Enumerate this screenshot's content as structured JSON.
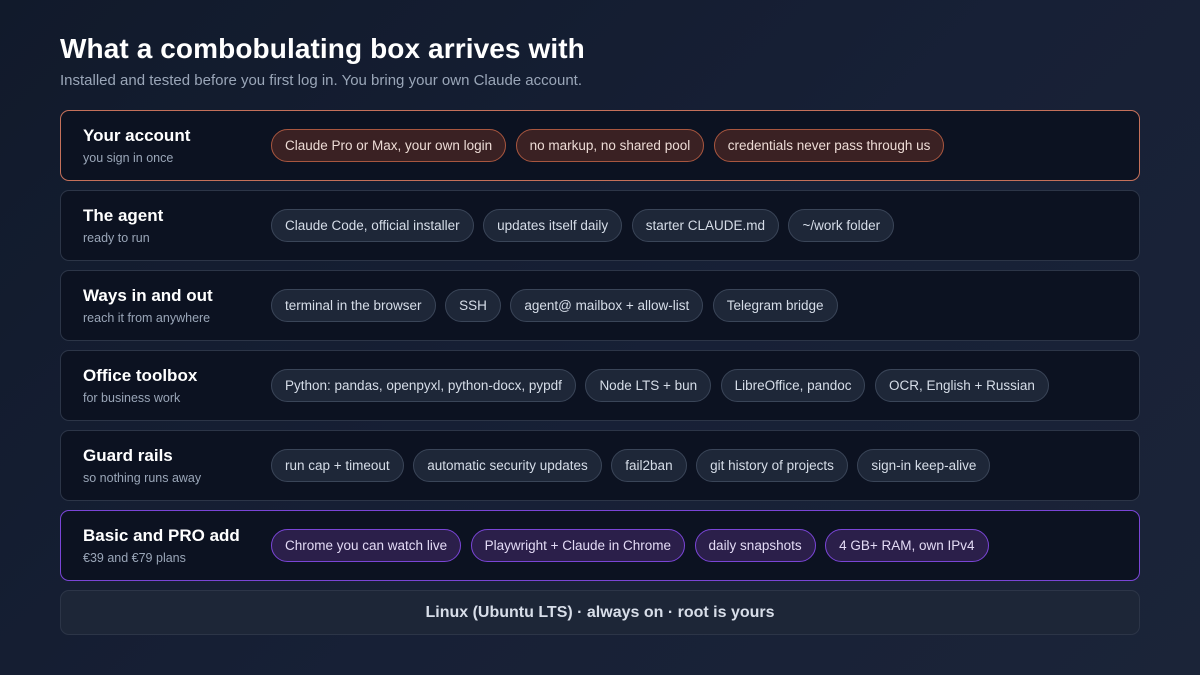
{
  "header": {
    "title": "What a combobulating box arrives with",
    "subtitle": "Installed and tested before you first log in. You bring your own Claude account."
  },
  "accent_colors": {
    "orange": "#c5705a",
    "purple": "#7a45d6"
  },
  "rows": [
    {
      "title": "Your account",
      "subtitle": "you sign in once",
      "accent": "orange",
      "chips": [
        "Claude Pro or Max, your own login",
        "no markup, no shared pool",
        "credentials never pass through us"
      ]
    },
    {
      "title": "The agent",
      "subtitle": "ready to run",
      "accent": "none",
      "chips": [
        "Claude Code, official installer",
        "updates itself daily",
        "starter CLAUDE.md",
        "~/work folder"
      ]
    },
    {
      "title": "Ways in and out",
      "subtitle": "reach it from anywhere",
      "accent": "none",
      "chips": [
        "terminal in the browser",
        "SSH",
        "agent@ mailbox + allow-list",
        "Telegram bridge"
      ]
    },
    {
      "title": "Office toolbox",
      "subtitle": "for business work",
      "accent": "none",
      "chips": [
        "Python: pandas, openpyxl, python-docx, pypdf",
        "Node LTS + bun",
        "LibreOffice, pandoc",
        "OCR, English + Russian"
      ]
    },
    {
      "title": "Guard rails",
      "subtitle": "so nothing runs away",
      "accent": "none",
      "chips": [
        "run cap + timeout",
        "automatic security updates",
        "fail2ban",
        "git history of projects",
        "sign-in keep-alive"
      ]
    },
    {
      "title": "Basic and PRO add",
      "subtitle": "€39 and €79 plans",
      "accent": "purple",
      "chips": [
        "Chrome you can watch live",
        "Playwright + Claude in Chrome",
        "daily snapshots",
        "4 GB+ RAM, own IPv4"
      ]
    }
  ],
  "footer": {
    "text": "Linux (Ubuntu LTS) · always on · root is yours"
  }
}
